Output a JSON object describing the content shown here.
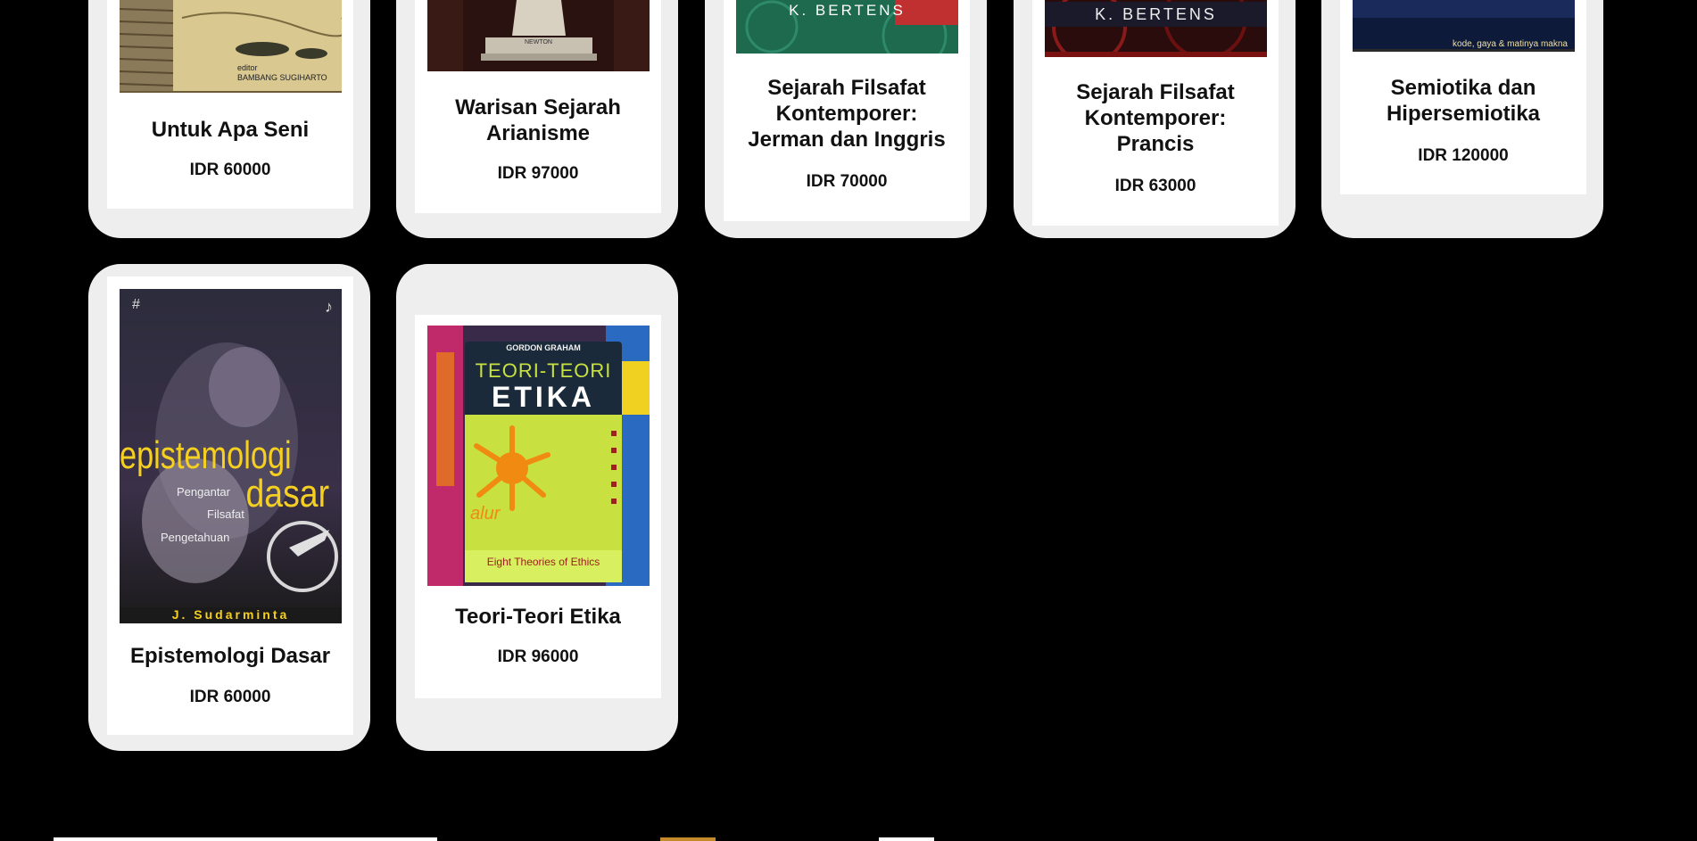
{
  "currency": "IDR",
  "products": [
    {
      "title": "Untuk Apa Seni",
      "price": "IDR 60000",
      "cover_text": "editor\nBAMBANG SUGIHARTO"
    },
    {
      "title": "Warisan Sejarah\nArianisme",
      "price": "IDR 97000",
      "cover_text": "NEWTON"
    },
    {
      "title": "Sejarah Filsafat\nKontemporer:\nJerman dan Inggris",
      "price": "IDR 70000",
      "cover_text": "K. BERTENS"
    },
    {
      "title": "Sejarah Filsafat\nKontemporer:\nPrancis",
      "price": "IDR 63000",
      "cover_text": "K. BERTENS"
    },
    {
      "title": "Semiotika dan\nHipersemiotika",
      "price": "IDR 120000",
      "cover_text": "kode, gaya & matinya makna"
    },
    {
      "title": "Epistemologi Dasar",
      "price": "IDR 60000",
      "cover_text": {
        "word1": "epistemologi",
        "word2": "dasar",
        "sub1": "Pengantar",
        "sub2": "Filsafat",
        "sub3": "Pengetahuan",
        "author": "J. Sudarminta"
      }
    },
    {
      "title": "Teori-Teori Etika",
      "price": "IDR 96000",
      "cover_text": {
        "author": "GORDON GRAHAM",
        "line1": "TEORI-TEORI",
        "line2": "ETIKA",
        "sub": "Eight Theories of Ethics",
        "mark": "alur"
      }
    }
  ],
  "colors": {
    "background": "#000000",
    "card_outer": "#eeeeee",
    "card_inner": "#ffffff",
    "text": "#111111"
  }
}
